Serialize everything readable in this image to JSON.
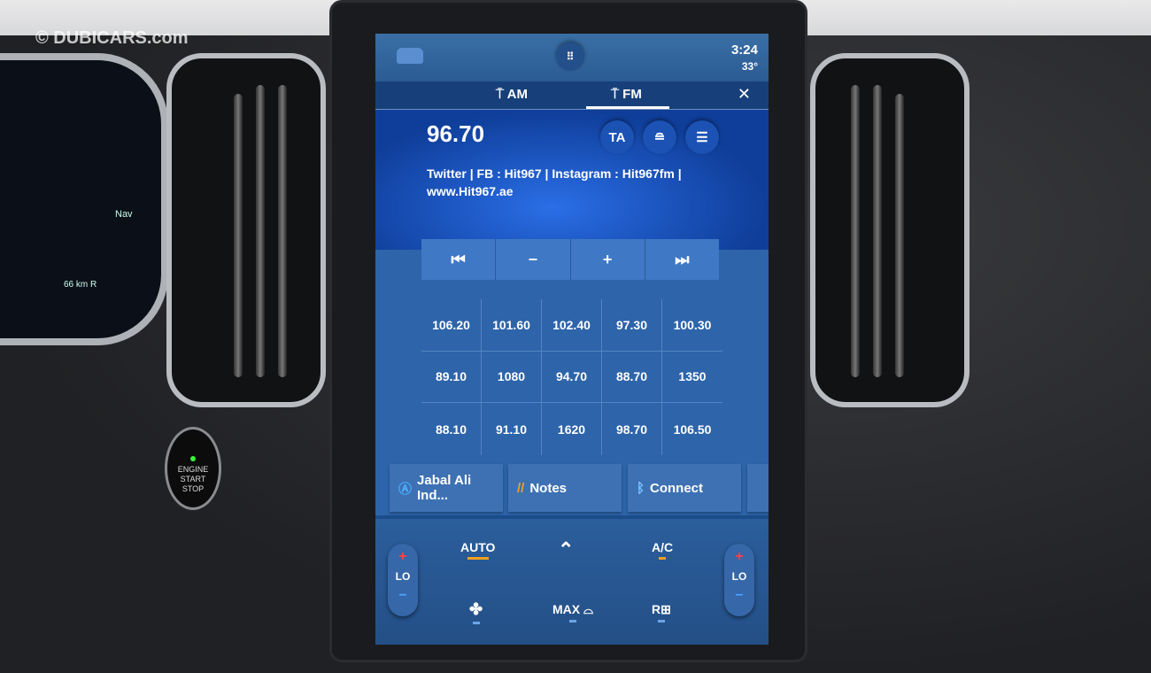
{
  "watermark": "© DUBICARS.com",
  "cluster": {
    "nav_label": "Nav",
    "range": "66 km R"
  },
  "start_button": {
    "line1": "ENGINE",
    "line2": "START",
    "line3": "STOP"
  },
  "topbar": {
    "time": "3:24",
    "temperature": "33°",
    "icons": [
      "car-icon",
      "app-grid-icon"
    ]
  },
  "tabs": [
    {
      "label": "AM",
      "icon": "am-antenna-icon",
      "active": false
    },
    {
      "label": "FM",
      "icon": "fm-antenna-icon",
      "active": true
    }
  ],
  "station": {
    "frequency": "96.70",
    "radio_text": "Twitter  |  FB  :  Hit967  |  Instagram  :  Hit967fm  |  www.Hit967.ae",
    "buttons": [
      {
        "label": "TA"
      },
      {
        "icon": "station-search-icon"
      },
      {
        "icon": "settings-sliders-icon"
      }
    ]
  },
  "controls": [
    {
      "label": "⏮",
      "icon": "seek-back-icon"
    },
    {
      "label": "−",
      "icon": "minus-icon"
    },
    {
      "label": "+",
      "icon": "plus-icon"
    },
    {
      "label": "⏭",
      "icon": "seek-forward-icon"
    }
  ],
  "presets": [
    "106.20",
    "101.60",
    "102.40",
    "97.30",
    "100.30",
    "89.10",
    "1080",
    "94.70",
    "88.70",
    "1350",
    "88.10",
    "91.10",
    "1620",
    "98.70",
    "106.50"
  ],
  "shortcuts": [
    {
      "label": "Jabal Ali Ind...",
      "icon": "navigation-icon"
    },
    {
      "label": "Notes",
      "icon": "notes-icon"
    },
    {
      "label": "Connect",
      "icon": "bluetooth-icon"
    }
  ],
  "climate": {
    "left_temp": "LO",
    "right_temp": "LO",
    "auto": "AUTO",
    "ac": "A/C",
    "max": "MAX",
    "rear": "R",
    "plus": "+",
    "minus": "−"
  },
  "colors": {
    "screen_bg": "#1a4d8a",
    "accent_orange": "#f0a020",
    "temp_up": "#ff4040",
    "temp_down": "#4aa3ff"
  }
}
